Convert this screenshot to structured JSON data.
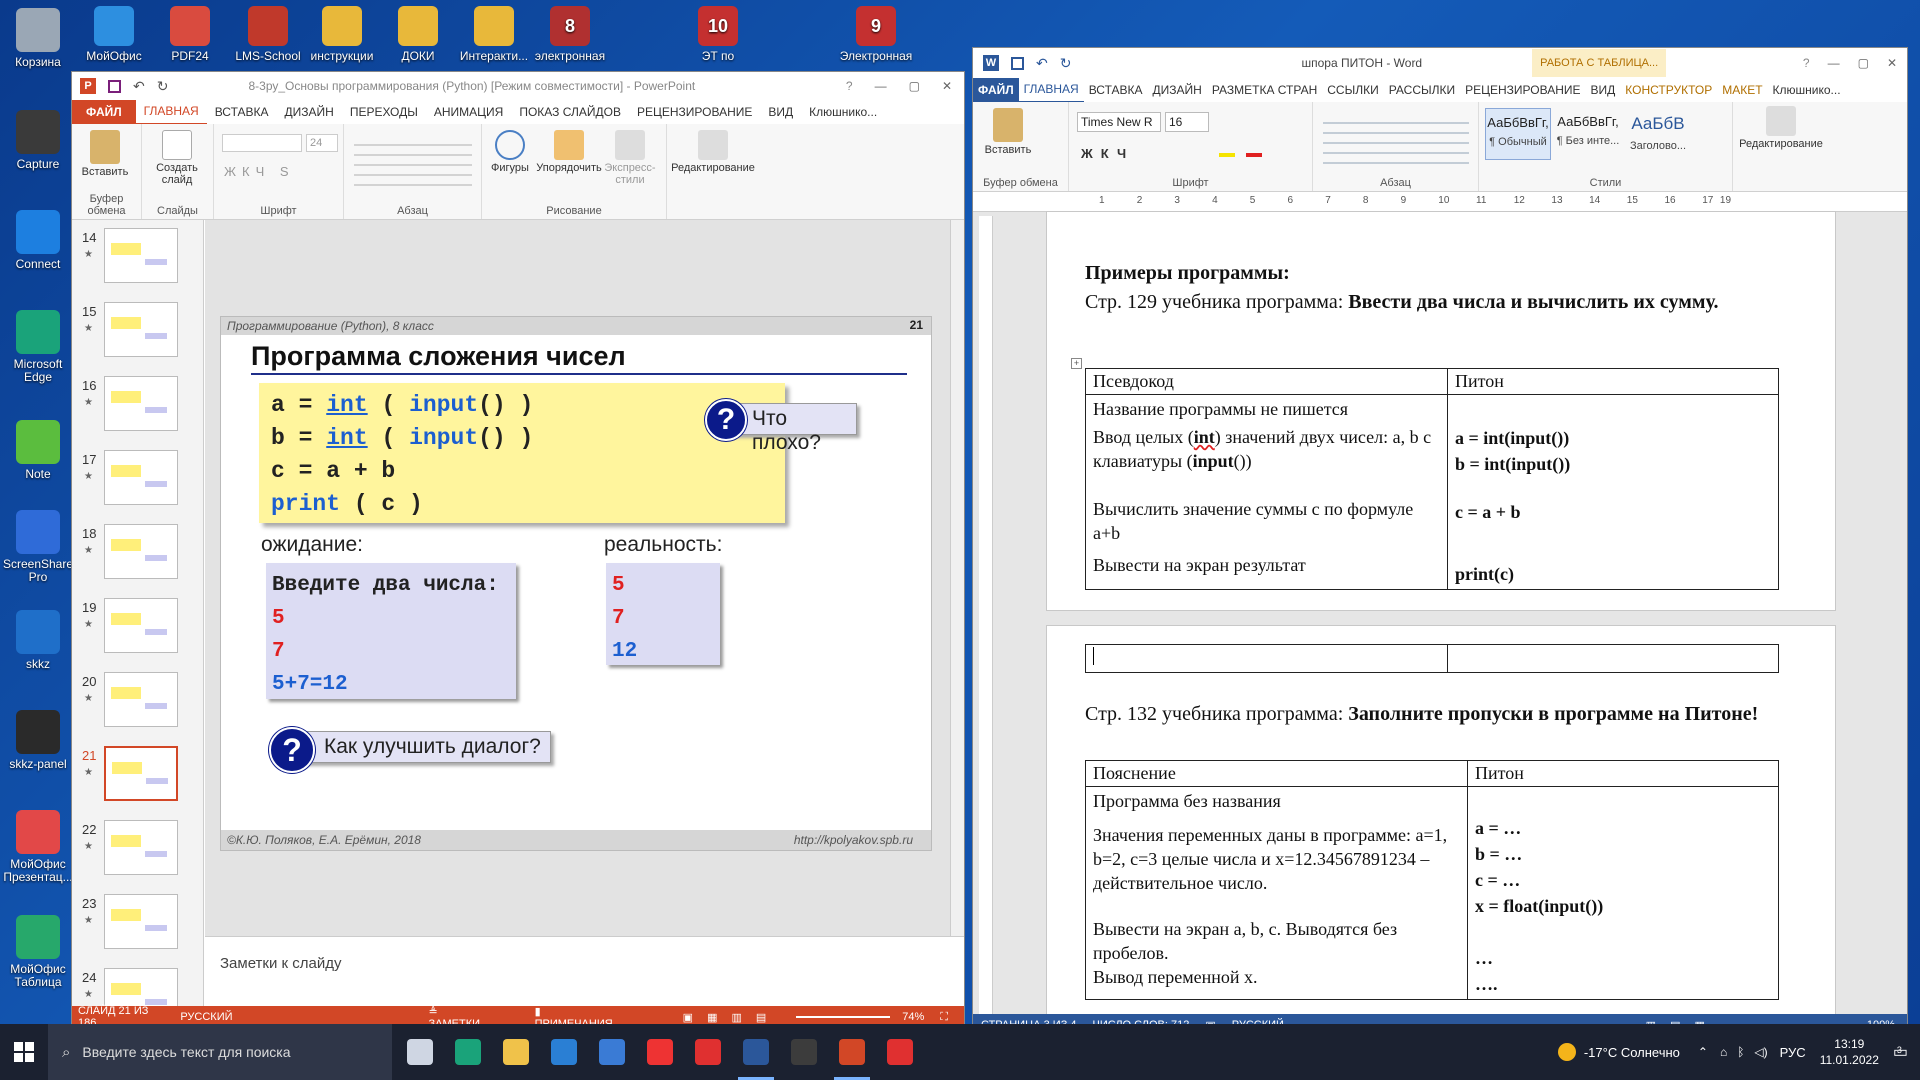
{
  "desktop": {
    "left_icons": [
      {
        "label": "Корзина",
        "color": "#9aa7b5"
      },
      {
        "label": "Capture",
        "color": "#3a3a3a"
      },
      {
        "label": "Connect",
        "color": "#1d7fe0"
      },
      {
        "label": "Microsoft Edge",
        "color": "#1aa37a"
      },
      {
        "label": "Note",
        "color": "#5bbd3e"
      },
      {
        "label": "ScreenShare Pro",
        "color": "#2f6bd8"
      },
      {
        "label": "skkz",
        "color": "#1f6fc9"
      },
      {
        "label": "skkz-panel",
        "color": "#2a2a2a"
      },
      {
        "label": "МойОфис Презентац...",
        "color": "#e24848"
      },
      {
        "label": "МойОфис Таблица",
        "color": "#27a86b"
      }
    ],
    "top_icons": [
      {
        "label": "МойОфис",
        "color": "#2d8fe0"
      },
      {
        "label": "PDF24",
        "color": "#d94b3f"
      },
      {
        "label": "LMS-School",
        "color": "#c0392b"
      },
      {
        "label": "инструкции",
        "color": "#e8b83a"
      },
      {
        "label": "ДОКИ",
        "color": "#e8b83a"
      },
      {
        "label": "Интеракти...",
        "color": "#e8b83a"
      },
      {
        "label": "электронная",
        "color": "#b03030"
      },
      {
        "label": "ЭТ по",
        "color": "#c43030"
      },
      {
        "label": "Электронная",
        "color": "#c43030"
      }
    ],
    "top_icon_badges": [
      "8",
      "10",
      "9"
    ]
  },
  "ppt": {
    "title": "8-3ру_Основы программирования (Python) [Режим совместимости] - PowerPoint",
    "tabs": [
      "ФАЙЛ",
      "ГЛАВНАЯ",
      "ВСТАВКА",
      "ДИЗАЙН",
      "ПЕРЕХОДЫ",
      "АНИМАЦИЯ",
      "ПОКАЗ СЛАЙДОВ",
      "РЕЦЕНЗИРОВАНИЕ",
      "ВИД",
      "Клюшнико..."
    ],
    "groups": [
      "Буфер обмена",
      "Слайды",
      "Шрифт",
      "Абзац",
      "Рисование"
    ],
    "ribbon_buttons": {
      "paste": "Вставить",
      "new_slide": "Создать слайд",
      "shapes": "Фигуры",
      "arrange": "Упорядочить",
      "quick_styles": "Экспресс-стили",
      "editing": "Редактирование"
    },
    "font_size": "24",
    "thumbnails": [
      {
        "num": "14",
        "star": "★"
      },
      {
        "num": "15",
        "star": "★"
      },
      {
        "num": "16",
        "star": "★"
      },
      {
        "num": "17",
        "star": "★"
      },
      {
        "num": "18",
        "star": "★"
      },
      {
        "num": "19",
        "star": "★"
      },
      {
        "num": "20",
        "star": "★"
      },
      {
        "num": "21",
        "star": "★"
      },
      {
        "num": "22",
        "star": "★"
      },
      {
        "num": "23",
        "star": "★"
      },
      {
        "num": "24",
        "star": "★"
      }
    ],
    "slide": {
      "header_left": "Программирование (Python), 8 класс",
      "number": "21",
      "title": "Программа сложения чисел",
      "code": {
        "l1": {
          "a": "a",
          "eq": "=",
          "int": "int",
          "lp": "(",
          "input": "input",
          "pp": "()",
          "rp": ")"
        },
        "l2": {
          "a": "b",
          "eq": "=",
          "int": "int",
          "lp": "(",
          "input": "input",
          "pp": "()",
          "rp": ")"
        },
        "l3": "c = a + b",
        "l4": {
          "print": "print",
          "rest": "( c )"
        }
      },
      "q1": "Что плохо?",
      "expect_label": "ожидание:",
      "reality_label": "реальность:",
      "expect_lines": [
        "Введите два числа:",
        "5",
        "7",
        "5+7=12"
      ],
      "reality_lines": [
        "5",
        "7",
        "12"
      ],
      "q2": "Как улучшить диалог?",
      "footer_left": "©К.Ю. Поляков, Е.А. Ерёмин, 2018",
      "footer_right": "http://kpolyakov.spb.ru",
      "qmark": "?"
    },
    "notes_placeholder": "Заметки к слайду",
    "status": {
      "slide": "СЛАЙД 21 ИЗ 186",
      "lang": "РУССКИЙ",
      "notes": "ЗАМЕТКИ",
      "comments": "ПРИМЕЧАНИЯ",
      "zoom": "74%"
    }
  },
  "word": {
    "title": "шпора ПИТОН - Word",
    "context_tab": "РАБОТА С ТАБЛИЦА...",
    "tabs": [
      "ФАЙЛ",
      "ГЛАВНАЯ",
      "ВСТАВКА",
      "ДИЗАЙН",
      "РАЗМЕТКА СТРАН",
      "ССЫЛКИ",
      "РАССЫЛКИ",
      "РЕЦЕНЗИРОВАНИЕ",
      "ВИД",
      "КОНСТРУКТОР",
      "МАКЕТ",
      "Клюшнико..."
    ],
    "font_name": "Times New R",
    "font_size": "16",
    "groups": [
      "Буфер обмена",
      "Шрифт",
      "Абзац",
      "Стили",
      "Редактирование"
    ],
    "paste": "Вставить",
    "styles": [
      {
        "sample": "АаБбВвГг,",
        "name": "¶ Обычный"
      },
      {
        "sample": "АаБбВвГг,",
        "name": "¶ Без инте..."
      },
      {
        "sample": "АаБбВ",
        "name": "Заголово..."
      }
    ],
    "editing": "Редактирование",
    "ruler_numbers": [
      "1",
      "2",
      "3",
      "4",
      "5",
      "6",
      "7",
      "8",
      "9",
      "10",
      "11",
      "12",
      "13",
      "14",
      "15",
      "16",
      "17",
      "19"
    ],
    "page1": {
      "heading": "Примеры программы:",
      "intro_plain": "Стр. 129 учебника программа: ",
      "intro_bold": "Ввести два числа и вычислить их сумму.",
      "col1": "Псевдокод",
      "col2": "Питон",
      "r1": "Название программы не пишется",
      "r2_pre": "Ввод целых (",
      "r2_int": "int",
      "r2_mid": ") значений двух чисел: a, b с клавиатуры (",
      "r2_input": "input",
      "r2_post": "())",
      "r2_py1": "a = int(input())",
      "r2_py2": "b = int(input())",
      "r3": "Вычислить значение суммы с по формуле a+b",
      "r3_py": "c = a + b",
      "r4": "Вывести на экран результат",
      "r4_py": "print(c)"
    },
    "page2": {
      "intro_plain": "Стр. 132 учебника программа: ",
      "intro_bold": "Заполните пропуски в программе на Питоне!",
      "col1": "Пояснение",
      "col2": "Питон",
      "r1": "Программа без названия",
      "r2": "Значения переменных даны в программе: a=1, b=2, c=3 целые числа и x=12.34567891234 – действительное число.",
      "r2_py": [
        "a = …",
        "b = …",
        "c = …",
        "x = float(input())"
      ],
      "r3a": "Вывести на экран a, b, c. Выводятся без пробелов.",
      "r3b": "Вывод переменной x.",
      "r3_py": [
        "…",
        "…."
      ]
    },
    "status": {
      "page": "СТРАНИЦА 3 ИЗ 4",
      "words": "ЧИСЛО СЛОВ: 712",
      "lang": "РУССКИЙ",
      "zoom": "100%"
    }
  },
  "taskbar": {
    "search_placeholder": "Введите здесь текст для поиска",
    "weather": "-17°C Солнечно",
    "lang": "РУС",
    "time": "13:19",
    "date": "11.01.2022",
    "notif_count": "3",
    "apps": [
      {
        "name": "task-view",
        "color": "#cfd6e3"
      },
      {
        "name": "edge",
        "color": "#1aa37a"
      },
      {
        "name": "explorer",
        "color": "#f0c24a"
      },
      {
        "name": "mail",
        "color": "#2a7fd4"
      },
      {
        "name": "store",
        "color": "#3a7bd5"
      },
      {
        "name": "yandex-music",
        "color": "#e33"
      },
      {
        "name": "yandex",
        "color": "#e03030"
      },
      {
        "name": "word",
        "color": "#2b579a"
      },
      {
        "name": "abbyy",
        "color": "#3c3c3c"
      },
      {
        "name": "powerpoint",
        "color": "#d24726"
      },
      {
        "name": "yandex-browser",
        "color": "#e03030"
      }
    ]
  }
}
